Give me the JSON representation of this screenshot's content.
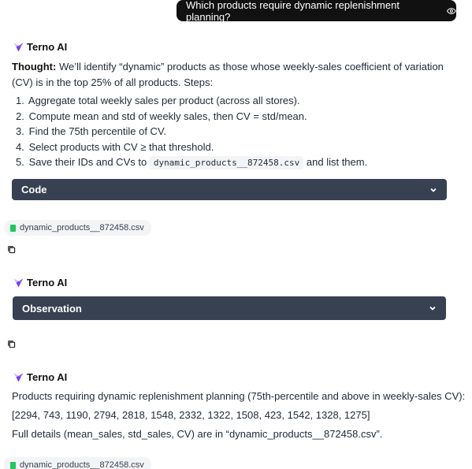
{
  "user_message": {
    "text": "Which products require dynamic replenishment planning?",
    "icon": "eye-icon"
  },
  "assistant_name": "Terno AI",
  "thought": {
    "label": "Thought:",
    "text": "We’ll identify “dynamic” products as those whose weekly-sales coefficient of variation (CV) is in the top 25% of all products. Steps:"
  },
  "steps": [
    {
      "num": "1.",
      "text": "Aggregate total weekly sales per product (across all stores)."
    },
    {
      "num": "2.",
      "text": "Compute mean and std of weekly sales, then CV = std/mean."
    },
    {
      "num": "3.",
      "text": "Find the 75th percentile of CV."
    },
    {
      "num": "4.",
      "text": "Select products with CV ≥ that threshold."
    },
    {
      "num": "5.",
      "text_before": "Save their IDs and CVs to",
      "code": "dynamic_products__872458.csv",
      "text_after": "and list them."
    }
  ],
  "code_panel": {
    "label": "Code"
  },
  "observation_panel": {
    "label": "Observation"
  },
  "file_name": "dynamic_products__872458.csv",
  "result": {
    "line1": "Products requiring dynamic replenishment planning (75th-percentile and above in weekly-sales CV):",
    "line2": "[2294, 743, 1190, 2794, 2818, 1548, 2332, 1322, 1508, 423, 1542, 1328, 1275]",
    "line3": "Full details (mean_sales, std_sales, CV) are in “dynamic_products__872458.csv”."
  },
  "colors": {
    "panel_bg": "#374151",
    "user_bubble_bg": "#111111",
    "file_icon": "#22c55e",
    "logo": "#8b5cf6"
  }
}
